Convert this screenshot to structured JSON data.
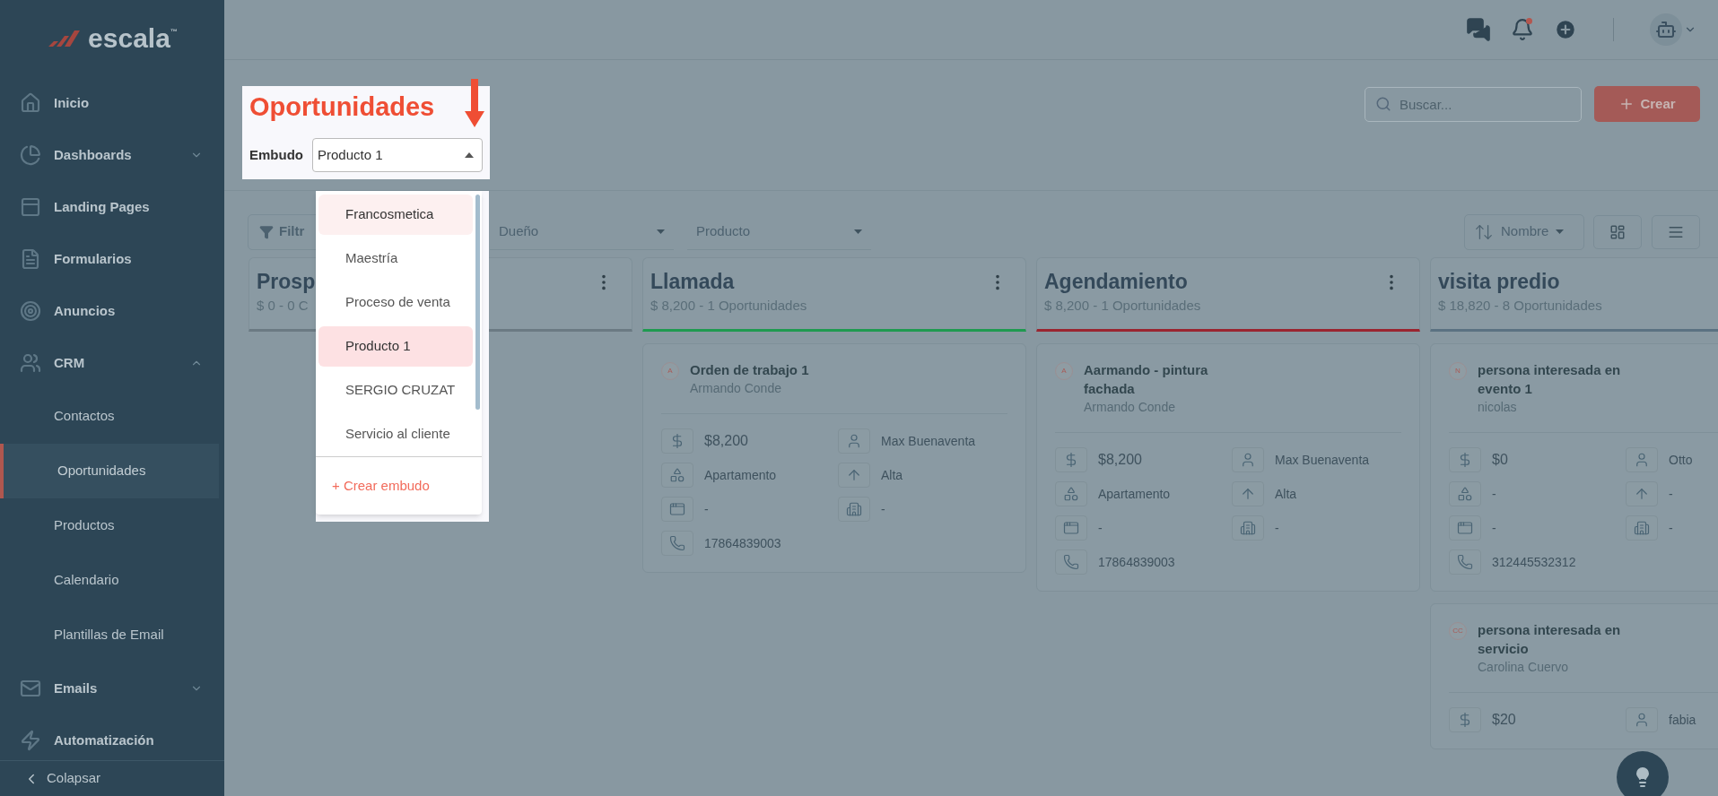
{
  "logo": {
    "text": "escala",
    "mark": "™"
  },
  "sidebar": {
    "items": [
      {
        "label": "Inicio"
      },
      {
        "label": "Dashboards",
        "expanded": false
      },
      {
        "label": "Landing Pages"
      },
      {
        "label": "Formularios"
      },
      {
        "label": "Anuncios"
      },
      {
        "label": "CRM",
        "expanded": true,
        "children": [
          {
            "label": "Contactos",
            "selected": false
          },
          {
            "label": "Oportunidades",
            "selected": true
          },
          {
            "label": "Productos",
            "selected": false
          },
          {
            "label": "Calendario",
            "selected": false
          },
          {
            "label": "Plantillas de Email",
            "selected": false
          }
        ]
      },
      {
        "label": "Emails",
        "expanded": false
      },
      {
        "label": "Automatización"
      }
    ],
    "collapse": "Colapsar"
  },
  "topbar": {
    "notification_dot": true
  },
  "header": {
    "title": "Oportunidades",
    "funnel_label": "Embudo",
    "funnel_value": "Producto 1",
    "search_placeholder": "Buscar...",
    "create_button": "Crear"
  },
  "funnel_menu": {
    "expanded": true,
    "options": [
      {
        "label": "Francosmetica",
        "selected": false,
        "hovered": true
      },
      {
        "label": "Maestría",
        "selected": false,
        "hovered": false
      },
      {
        "label": "Proceso de venta",
        "selected": false,
        "hovered": false
      },
      {
        "label": "Producto 1",
        "selected": true,
        "hovered": false
      },
      {
        "label": "SERGIO CRUZAT",
        "selected": false,
        "hovered": false
      },
      {
        "label": "Servicio al cliente",
        "selected": false,
        "hovered": false
      }
    ],
    "create": "+ Crear embudo"
  },
  "filters": [
    {
      "kind": "button",
      "label": "Filtr"
    },
    {
      "kind": "select",
      "label": "Dueño"
    },
    {
      "kind": "select",
      "label": "Producto"
    }
  ],
  "sort": {
    "label": "Nombre"
  },
  "columns": [
    {
      "title": "Prosp",
      "summary": "$ 0 - 0 C",
      "color": "#6b7a83",
      "menu": true
    },
    {
      "title": "Llamada",
      "summary": "$ 8,200 - 1 Oportunidades",
      "color": "#1f9a50",
      "menu": true,
      "cards": [
        {
          "initials": "A",
          "title": "Orden de trabajo 1",
          "person": "Armando Conde",
          "amount": "$8,200",
          "owner": "Max Buenaventa",
          "type": "Apartamento",
          "priority": "Alta",
          "date": "-",
          "company": "-",
          "phone": "17864839003"
        }
      ]
    },
    {
      "title": "Agendamiento",
      "summary": "$ 8,200 - 1 Oportunidades",
      "color": "#9a2530",
      "menu": true,
      "cards": [
        {
          "initials": "A",
          "title": "Aarmando - pintura fachada",
          "person": "Armando Conde",
          "amount": "$8,200",
          "owner": "Max Buenaventa",
          "type": "Apartamento",
          "priority": "Alta",
          "date": "-",
          "company": "-",
          "phone": "17864839003"
        }
      ]
    },
    {
      "title": "visita predio",
      "summary": "$ 18,820 - 8 Oportunidades",
      "color": "#5b7282",
      "menu": false,
      "cards": [
        {
          "initials": "N",
          "title": "persona interesada en evento 1",
          "person": "nicolas",
          "amount": "$0",
          "owner": "Otto",
          "type": "-",
          "priority": "-",
          "date": "-",
          "company": "-",
          "phone": "312445532312"
        },
        {
          "initials": "CC",
          "title": "persona interesada en servicio",
          "person": "Carolina Cuervo",
          "amount": "$20",
          "owner": "fabia"
        }
      ]
    }
  ]
}
